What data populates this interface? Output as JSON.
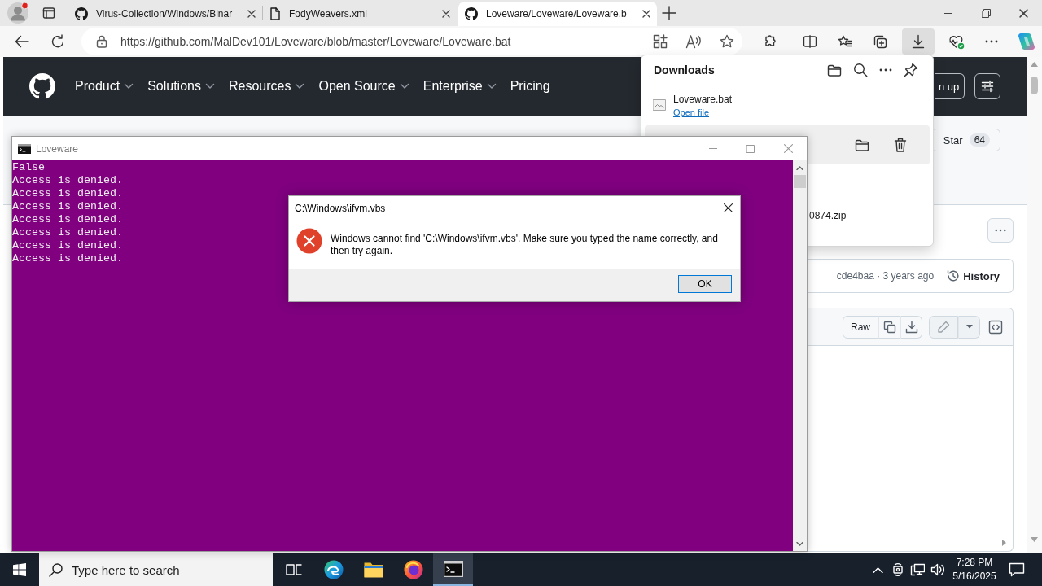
{
  "browser": {
    "tabs": [
      {
        "kind": "github",
        "title": "Virus-Collection/Windows/Binar",
        "selected": false
      },
      {
        "kind": "document",
        "title": "FodyWeavers.xml",
        "selected": false
      },
      {
        "kind": "github",
        "title": "Loveware/Loveware/Loveware.b",
        "selected": true
      }
    ],
    "address": "https://github.com/MalDev101/Loveware/blob/master/Loveware/Loveware.bat",
    "toolbar": [
      {
        "kind": "extensions",
        "selected": false
      },
      {
        "kind": "split-screen",
        "selected": false
      },
      {
        "kind": "favorites",
        "selected": false
      },
      {
        "kind": "collections",
        "selected": false
      },
      {
        "kind": "downloads",
        "selected": true
      },
      {
        "kind": "performance",
        "selected": false
      },
      {
        "kind": "more",
        "selected": false
      },
      {
        "kind": "copilot",
        "selected": false
      }
    ]
  },
  "github": {
    "nav": [
      {
        "label": "Product",
        "dropdown": true
      },
      {
        "label": "Solutions",
        "dropdown": true
      },
      {
        "label": "Resources",
        "dropdown": true
      },
      {
        "label": "Open Source",
        "dropdown": true
      },
      {
        "label": "Enterprise",
        "dropdown": true
      },
      {
        "label": "Pricing",
        "dropdown": false
      }
    ],
    "header_button": "n up",
    "star": {
      "label": "Star",
      "count": "64"
    },
    "commit": "cde4baa · 3 years ago",
    "history": "History",
    "raw": "Raw"
  },
  "downloads": {
    "title": "Downloads",
    "items": [
      {
        "name": "Loveware.bat",
        "link": "Open file",
        "file_icon": true,
        "hovered": false
      },
      {
        "hovered": true
      },
      {
        "name": "0874.zip",
        "hovered": false
      }
    ]
  },
  "console": {
    "title": "Loveware",
    "lines": [
      "False",
      "Access is denied.",
      "Access is denied.",
      "Access is denied.",
      "Access is denied.",
      "Access is denied.",
      "Access is denied.",
      "Access is denied."
    ]
  },
  "dialog": {
    "title": "C:\\Windows\\ifvm.vbs",
    "message": "Windows cannot find 'C:\\Windows\\ifvm.vbs'. Make sure you typed the name correctly, and then try again.",
    "button": "OK"
  },
  "taskbar": {
    "search_placeholder": "Type here to search",
    "apps": [
      {
        "kind": "task-view",
        "selected": false
      },
      {
        "kind": "edge",
        "selected": false
      },
      {
        "kind": "explorer",
        "selected": false
      },
      {
        "kind": "firefox",
        "selected": false
      },
      {
        "kind": "terminal",
        "selected": true
      }
    ],
    "time": "7:28 PM",
    "date": "5/16/2025"
  }
}
